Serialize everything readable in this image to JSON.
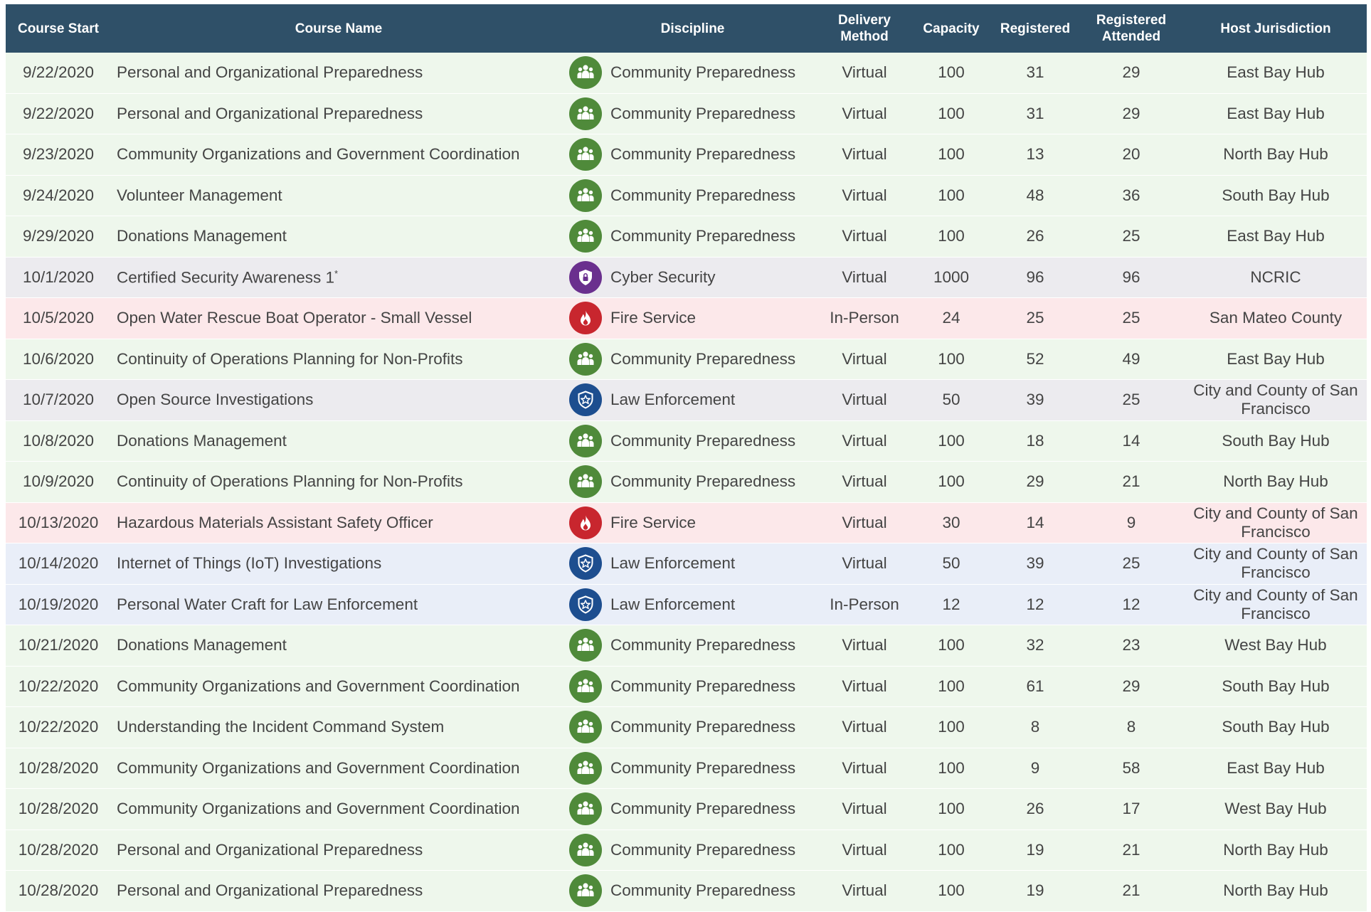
{
  "headers": {
    "course_start": "Course Start",
    "course_name": "Course Name",
    "discipline": "Discipline",
    "delivery_method": "Delivery Method",
    "capacity": "Capacity",
    "registered": "Registered",
    "registered_attended": "Registered Attended",
    "host_jurisdiction": "Host Jurisdiction"
  },
  "disciplines": {
    "community": {
      "label": "Community Preparedness",
      "color": "#4f8a3a",
      "icon": "people-group-icon",
      "row": "#eef7ec"
    },
    "cyber": {
      "label": "Cyber Security",
      "color": "#6a2f8e",
      "icon": "shield-lock-icon",
      "row": "#ecebef"
    },
    "fire": {
      "label": "Fire Service",
      "color": "#c8262e",
      "icon": "flame-icon",
      "row": "#fce8ea"
    },
    "law": {
      "label": "Law Enforcement",
      "color": "#1d4e8f",
      "icon": "police-badge-icon",
      "row": "#e9eef8"
    }
  },
  "rows": [
    {
      "start": "9/22/2020",
      "name": "Personal and Organizational Preparedness",
      "discipline": "community",
      "discipline_label": "Community Preparedness",
      "method": "Virtual",
      "capacity": "100",
      "registered": "31",
      "attended": "29",
      "jurisdiction": "East Bay Hub"
    },
    {
      "start": "9/22/2020",
      "name": "Personal and Organizational Preparedness",
      "discipline": "community",
      "discipline_label": "Community Preparedness",
      "method": "Virtual",
      "capacity": "100",
      "registered": "31",
      "attended": "29",
      "jurisdiction": "East Bay Hub"
    },
    {
      "start": "9/23/2020",
      "name": "Community Organizations and Government Coordination",
      "discipline": "community",
      "discipline_label": "Community Preparedness",
      "method": "Virtual",
      "capacity": "100",
      "registered": "13",
      "attended": "20",
      "jurisdiction": "North Bay Hub"
    },
    {
      "start": "9/24/2020",
      "name": "Volunteer Management",
      "discipline": "community",
      "discipline_label": "Community Preparedness",
      "method": "Virtual",
      "capacity": "100",
      "registered": "48",
      "attended": "36",
      "jurisdiction": "South Bay Hub"
    },
    {
      "start": "9/29/2020",
      "name": "Donations Management",
      "discipline": "community",
      "discipline_label": "Community Preparedness",
      "method": "Virtual",
      "capacity": "100",
      "registered": "26",
      "attended": "25",
      "jurisdiction": "East Bay Hub"
    },
    {
      "start": "10/1/2020",
      "name": "Certified Security Awareness 1",
      "name_sup": "*",
      "discipline": "cyber",
      "discipline_label": "Cyber Security",
      "method": "Virtual",
      "capacity": "1000",
      "registered": "96",
      "attended": "96",
      "jurisdiction": "NCRIC"
    },
    {
      "start": "10/5/2020",
      "name": "Open Water Rescue Boat Operator - Small Vessel",
      "discipline": "fire",
      "discipline_label": "Fire Service",
      "method": "In-Person",
      "capacity": "24",
      "registered": "25",
      "attended": "25",
      "jurisdiction": "San Mateo County"
    },
    {
      "start": "10/6/2020",
      "name": "Continuity of Operations Planning for Non-Profits",
      "discipline": "community",
      "discipline_label": "Community Preparedness",
      "method": "Virtual",
      "capacity": "100",
      "registered": "52",
      "attended": "49",
      "jurisdiction": "East Bay Hub"
    },
    {
      "start": "10/7/2020",
      "name": "Open Source Investigations",
      "discipline": "law",
      "discipline_label": "Law Enforcement",
      "row_tint": "gray",
      "method": "Virtual",
      "capacity": "50",
      "registered": "39",
      "attended": "25",
      "jurisdiction": "City and County of San Francisco"
    },
    {
      "start": "10/8/2020",
      "name": "Donations Management",
      "discipline": "community",
      "discipline_label": "Community Preparedness",
      "method": "Virtual",
      "capacity": "100",
      "registered": "18",
      "attended": "14",
      "jurisdiction": "South Bay Hub"
    },
    {
      "start": "10/9/2020",
      "name": "Continuity of Operations Planning for Non-Profits",
      "discipline": "community",
      "discipline_label": "Community Preparedness",
      "method": "Virtual",
      "capacity": "100",
      "registered": "29",
      "attended": "21",
      "jurisdiction": "North Bay Hub"
    },
    {
      "start": "10/13/2020",
      "name": "Hazardous Materials Assistant Safety Officer",
      "discipline": "fire",
      "discipline_label": "Fire Service",
      "method": "Virtual",
      "capacity": "30",
      "registered": "14",
      "attended": "9",
      "jurisdiction": "City and County of San Francisco"
    },
    {
      "start": "10/14/2020",
      "name": "Internet of Things (IoT) Investigations",
      "discipline": "law",
      "discipline_label": "Law Enforcement",
      "method": "Virtual",
      "capacity": "50",
      "registered": "39",
      "attended": "25",
      "jurisdiction": "City and County of San Francisco"
    },
    {
      "start": "10/19/2020",
      "name": "Personal Water Craft for Law Enforcement",
      "discipline": "law",
      "discipline_label": "Law Enforcement",
      "method": "In-Person",
      "capacity": "12",
      "registered": "12",
      "attended": "12",
      "jurisdiction": "City and County of San Francisco"
    },
    {
      "start": "10/21/2020",
      "name": "Donations Management",
      "discipline": "community",
      "discipline_label": "Community Preparedness",
      "method": "Virtual",
      "capacity": "100",
      "registered": "32",
      "attended": "23",
      "jurisdiction": "West Bay Hub"
    },
    {
      "start": "10/22/2020",
      "name": "Community Organizations and Government Coordination",
      "discipline": "community",
      "discipline_label": "Community Preparedness",
      "method": "Virtual",
      "capacity": "100",
      "registered": "61",
      "attended": "29",
      "jurisdiction": "South Bay Hub"
    },
    {
      "start": "10/22/2020",
      "name": "Understanding the Incident Command System",
      "discipline": "community",
      "discipline_label": "Community Preparedness",
      "method": "Virtual",
      "capacity": "100",
      "registered": "8",
      "attended": "8",
      "jurisdiction": "South Bay Hub"
    },
    {
      "start": "10/28/2020",
      "name": "Community Organizations and Government Coordination",
      "discipline": "community",
      "discipline_label": "Community Preparedness",
      "method": "Virtual",
      "capacity": "100",
      "registered": "9",
      "attended": "58",
      "jurisdiction": "East Bay Hub"
    },
    {
      "start": "10/28/2020",
      "name": "Community Organizations and Government Coordination",
      "discipline": "community",
      "discipline_label": "Community Preparedness",
      "method": "Virtual",
      "capacity": "100",
      "registered": "26",
      "attended": "17",
      "jurisdiction": "West Bay Hub"
    },
    {
      "start": "10/28/2020",
      "name": "Personal and Organizational Preparedness",
      "discipline": "community",
      "discipline_label": "Community Preparedness",
      "method": "Virtual",
      "capacity": "100",
      "registered": "19",
      "attended": "21",
      "jurisdiction": "North Bay Hub"
    },
    {
      "start": "10/28/2020",
      "name": "Personal and Organizational Preparedness",
      "discipline": "community",
      "discipline_label": "Community Preparedness",
      "method": "Virtual",
      "capacity": "100",
      "registered": "19",
      "attended": "21",
      "jurisdiction": "North Bay Hub"
    }
  ]
}
